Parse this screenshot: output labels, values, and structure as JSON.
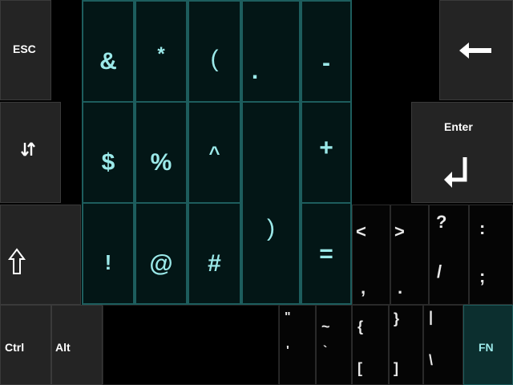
{
  "keyboard": {
    "esc": "ESC",
    "enter": "Enter",
    "ctrl": "Ctrl",
    "alt": "Alt",
    "fn": "FN",
    "numpad": {
      "amp": "&",
      "star": "*",
      "lparen": "(",
      "dot": ".",
      "minus": "-",
      "dollar": "$",
      "percent": "%",
      "caret": "^",
      "rparen": ")",
      "plus": "+",
      "excl": "!",
      "at": "@",
      "hash": "#",
      "equals": "="
    },
    "dual_keys": [
      {
        "top": "<",
        "bottom": ","
      },
      {
        "top": ">",
        "bottom": "."
      },
      {
        "top": "?",
        "bottom": "/"
      },
      {
        "top": ":",
        "bottom": ";"
      }
    ],
    "bottom_dual_keys": [
      {
        "top": "\"",
        "bottom": "'"
      },
      {
        "top": "~",
        "bottom": "`"
      },
      {
        "top": "{",
        "bottom": "["
      },
      {
        "top": "}",
        "bottom": "]"
      },
      {
        "top": "|",
        "bottom": "\\"
      }
    ],
    "icons": {
      "backspace": "arrow-left-icon",
      "switch": "swap-arrows-icon",
      "enter": "return-arrow-icon",
      "shift": "shift-arrow-icon"
    }
  }
}
